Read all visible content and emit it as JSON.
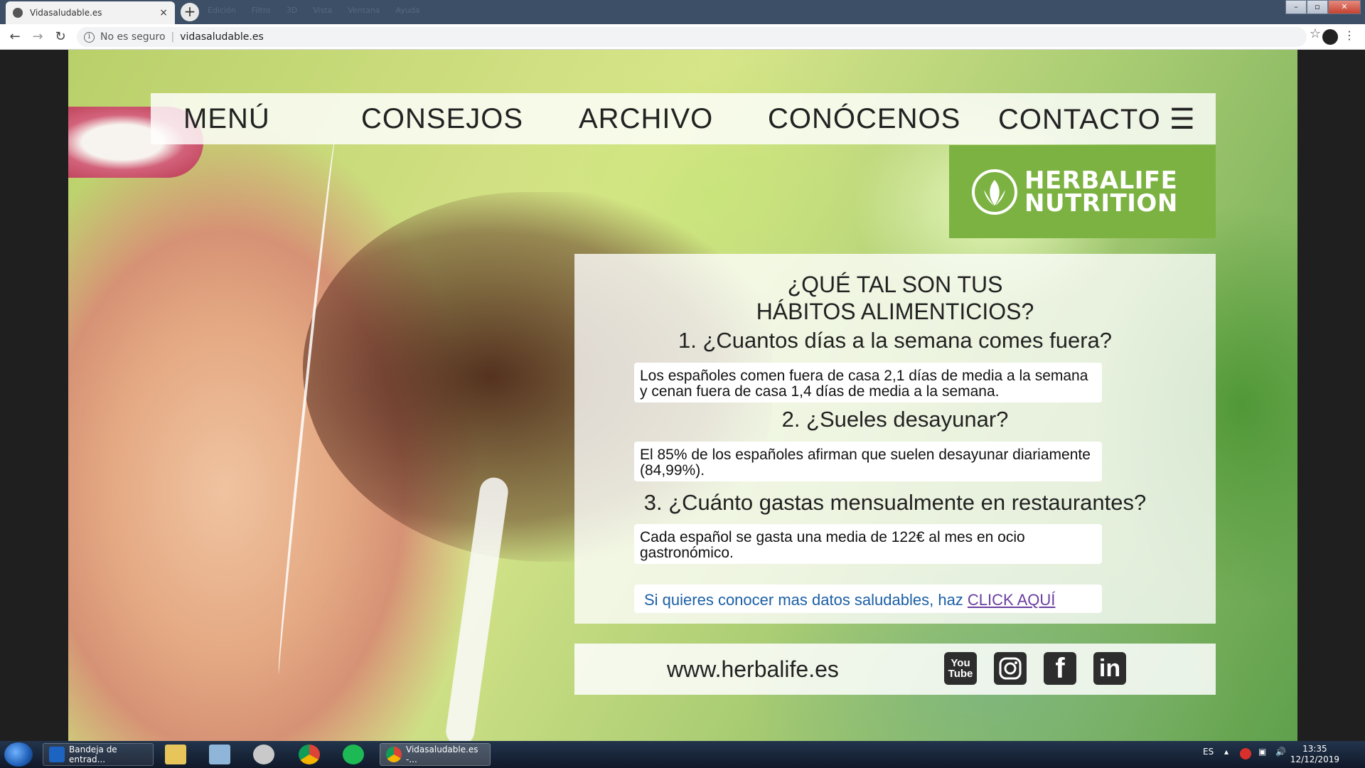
{
  "browser": {
    "tab_title": "Vidasaludable.es",
    "tab_close": "×",
    "new_tab": "+",
    "background_menu": [
      "Edición",
      "Filtro",
      "3D",
      "Vista",
      "Ventana",
      "Ayuda"
    ],
    "security_label": "No es seguro",
    "url": "vidasaludable.es",
    "window_controls": [
      "–",
      "▫",
      "✕"
    ]
  },
  "nav": {
    "items": [
      "MENÚ",
      "CONSEJOS",
      "ARCHIVO",
      "CONÓCENOS",
      "CONTACTO ☰"
    ]
  },
  "logo": {
    "line1": "HERBALIFE",
    "line2": "NUTRITION",
    "color": "#7bb241"
  },
  "panel": {
    "title_line1": "¿QUÉ TAL SON TUS",
    "title_line2": "HÁBITOS ALIMENTICIOS?",
    "questions": [
      {
        "question": "1. ¿Cuantos días a la semana comes fuera?",
        "answer": "Los españoles comen fuera de casa 2,1 días de media a la semana y cenan fuera de casa 1,4 días de media a la semana."
      },
      {
        "question": "2. ¿Sueles desayunar?",
        "answer": "El 85% de los españoles afirman que suelen desayunar diariamente (84,99%)."
      },
      {
        "question": "3. ¿Cuánto gastas mensualmente en restaurantes?",
        "answer": "Cada español se gasta una media de 122€ al mes en ocio gastronómico."
      }
    ],
    "cta_text": "Si quieres conocer mas datos saludables, haz ",
    "cta_link": "CLICK AQUÍ"
  },
  "footer": {
    "website": "www.herbalife.es",
    "social": [
      "YouTube",
      "Instagram",
      "Facebook",
      "LinkedIn"
    ],
    "youtube_label_top": "You",
    "youtube_label_bottom": "Tube",
    "linkedin_label": "in",
    "facebook_label": "f"
  },
  "taskbar": {
    "outlook_label": "Bandeja de entrad...",
    "chrome_window_label": "Vidasaludable.es -...",
    "language": "ES",
    "time": "13:35",
    "date": "12/12/2019"
  }
}
